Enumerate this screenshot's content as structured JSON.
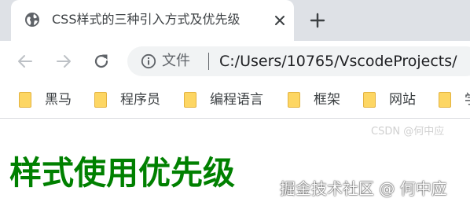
{
  "tab": {
    "title": "CSS样式的三种引入方式及优先级",
    "favicon_icon": "globe-icon",
    "close_icon": "close-icon"
  },
  "new_tab_icon": "plus-icon",
  "toolbar": {
    "back_icon": "arrow-left-icon",
    "forward_icon": "arrow-right-icon",
    "reload_icon": "reload-icon",
    "info_icon": "info-icon",
    "scheme_label": "文件",
    "url": "C:/Users/10765/VscodeProjects/"
  },
  "bookmarks": [
    {
      "label": "黑马",
      "icon": "folder-icon"
    },
    {
      "label": "程序员",
      "icon": "folder-icon"
    },
    {
      "label": "编程语言",
      "icon": "folder-icon"
    },
    {
      "label": "框架",
      "icon": "folder-icon"
    },
    {
      "label": "网站",
      "icon": "folder-icon"
    },
    {
      "label": "学",
      "icon": "folder-icon"
    }
  ],
  "page": {
    "heading": "样式使用优先级"
  },
  "watermarks": {
    "juejin": "掘金技术社区 @ 何中应",
    "csdn": "CSDN @何中应"
  },
  "colors": {
    "tab_strip": "#dee1e6",
    "omnibox": "#f1f3f4",
    "heading": "#008000",
    "folder": "#fdd663"
  }
}
